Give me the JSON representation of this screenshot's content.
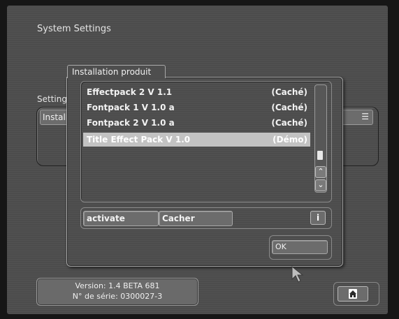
{
  "screen": {
    "title": "System Settings"
  },
  "background": {
    "setting_label": "Setting",
    "field_text": "Installation",
    "menu_icon": "menu-icon"
  },
  "dialog": {
    "tab_title": "Installation produit",
    "list": [
      {
        "name": "Effectpack 2  V 1.1",
        "status": "(Caché)",
        "selected": false
      },
      {
        "name": "Fontpack 1 V 1.0 a",
        "status": "(Caché)",
        "selected": false
      },
      {
        "name": "Fontpack 2 V 1.0 a",
        "status": "(Caché)",
        "selected": false
      },
      {
        "name": "Title Effect Pack V 1.0",
        "status": "(Démo)",
        "selected": true
      }
    ],
    "scroll": {
      "up_icon": "chevron-up-icon",
      "down_icon": "chevron-down-icon"
    },
    "buttons": {
      "activate": "activate",
      "hide": "Cacher",
      "info": "i",
      "ok": "OK"
    }
  },
  "footer": {
    "version": "Version: 1.4 BETA 681",
    "serial": "N° de série: 0300027-3",
    "home_icon": "home-icon"
  }
}
